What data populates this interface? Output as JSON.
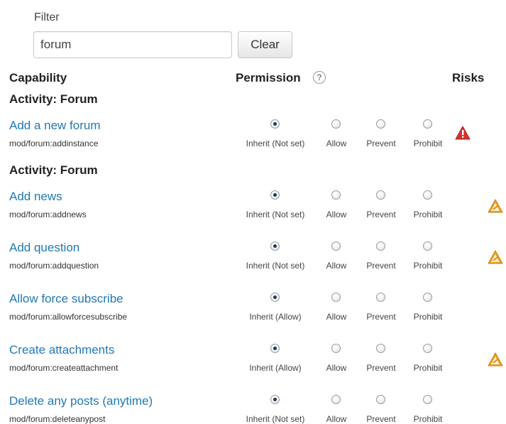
{
  "filter": {
    "label": "Filter",
    "value": "forum",
    "clear_label": "Clear"
  },
  "headers": {
    "capability": "Capability",
    "permission": "Permission",
    "help_glyph": "?",
    "risks": "Risks"
  },
  "option_labels": [
    "Allow",
    "Prevent",
    "Prohibit"
  ],
  "colors": {
    "link": "#1f78b4",
    "risk_high": "#d9302c",
    "risk_medium": "#f0a020"
  },
  "sections": [
    {
      "title": "Activity: Forum",
      "rows": [
        {
          "label": "Add a new forum",
          "name": "mod/forum:addinstance",
          "inherit": "Inherit (Not set)",
          "selected": "inherit",
          "risk": "risk-xss-icon"
        }
      ]
    },
    {
      "title": "Activity: Forum",
      "rows": [
        {
          "label": "Add news",
          "name": "mod/forum:addnews",
          "inherit": "Inherit (Not set)",
          "selected": "inherit",
          "risk": "risk-spam-icon"
        },
        {
          "label": "Add question",
          "name": "mod/forum:addquestion",
          "inherit": "Inherit (Not set)",
          "selected": "inherit",
          "risk": "risk-spam-icon"
        },
        {
          "label": "Allow force subscribe",
          "name": "mod/forum:allowforcesubscribe",
          "inherit": "Inherit (Allow)",
          "selected": "inherit",
          "risk": ""
        },
        {
          "label": "Create attachments",
          "name": "mod/forum:createattachment",
          "inherit": "Inherit (Allow)",
          "selected": "inherit",
          "risk": "risk-spam-icon"
        },
        {
          "label": "Delete any posts (anytime)",
          "name": "mod/forum:deleteanypost",
          "inherit": "Inherit (Not set)",
          "selected": "inherit",
          "risk": ""
        }
      ]
    }
  ]
}
